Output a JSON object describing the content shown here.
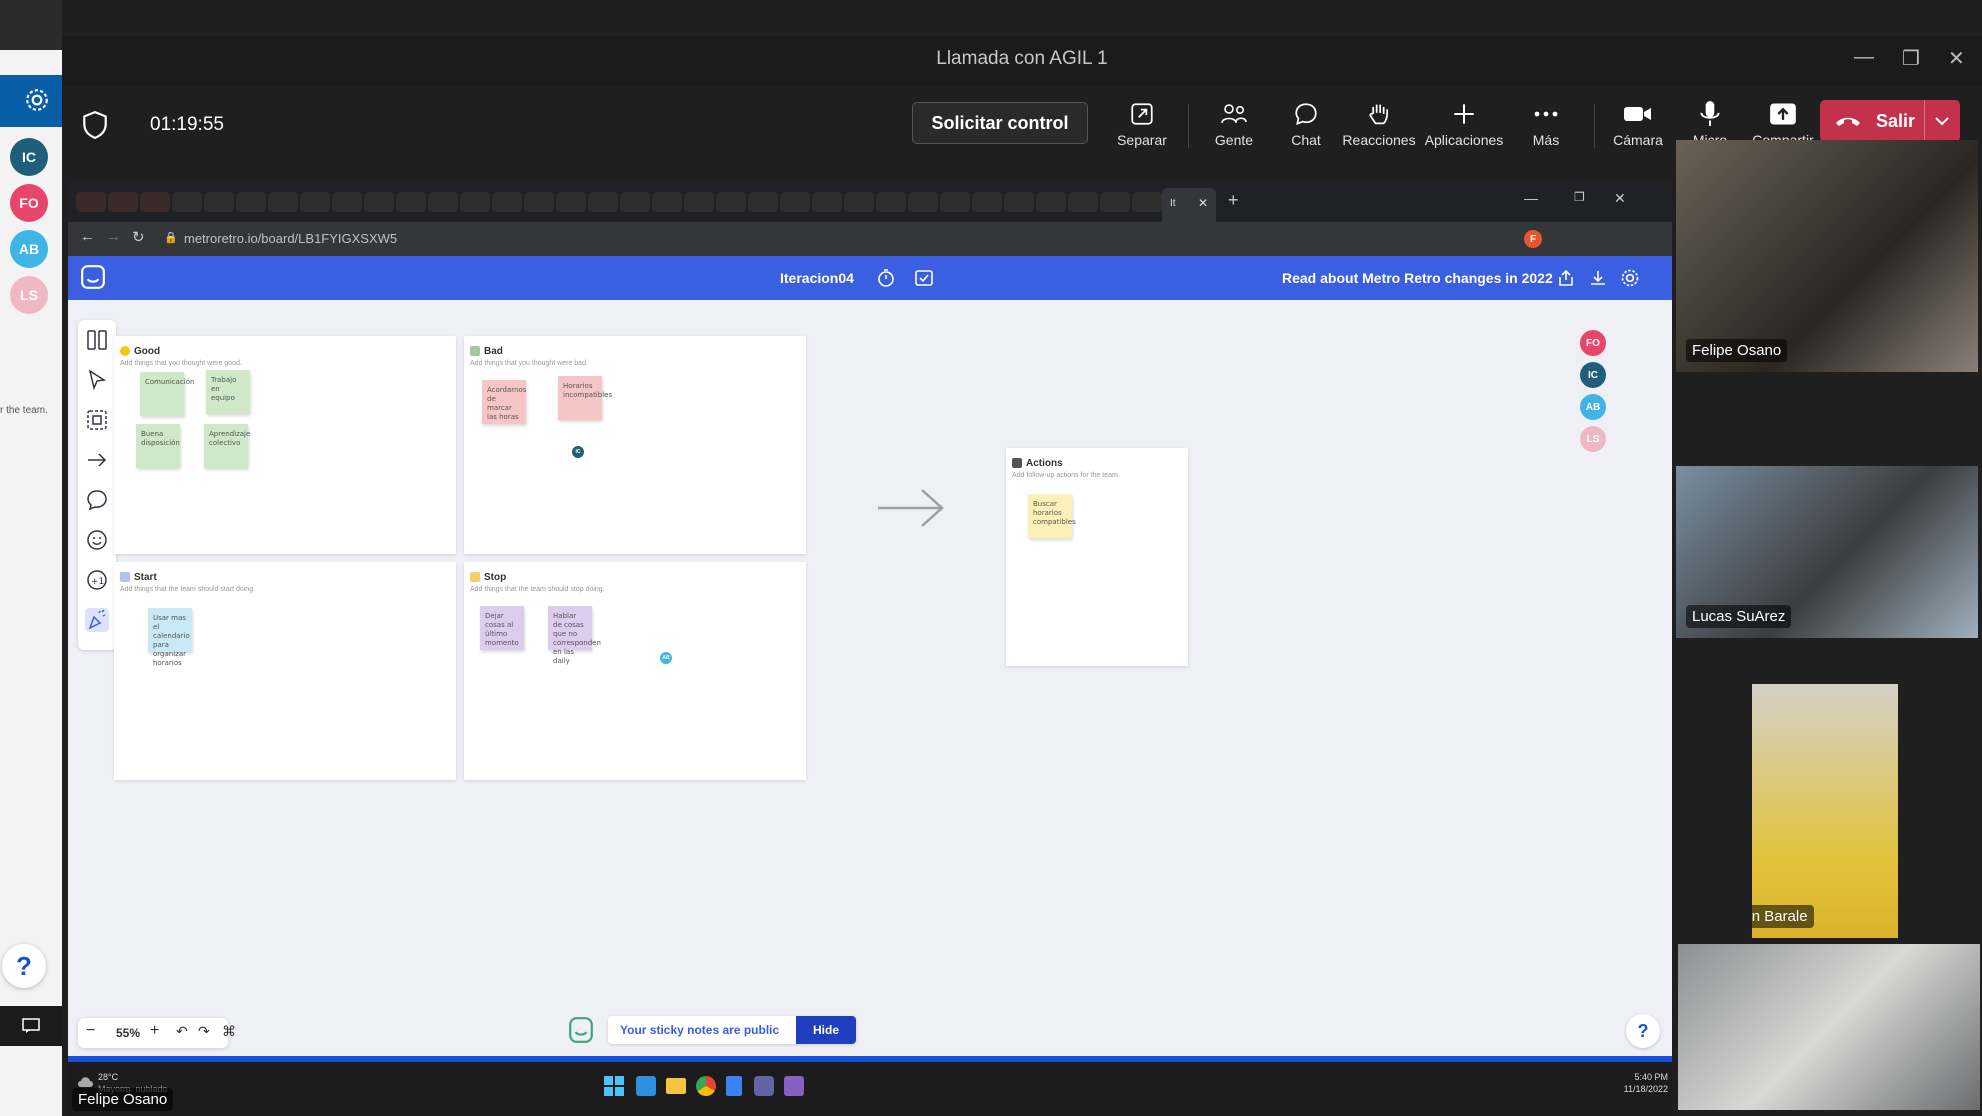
{
  "background_app": {
    "avatars": [
      {
        "initials": "IC",
        "color": "#1f5f7a"
      },
      {
        "initials": "FO",
        "color": "#e8456b"
      },
      {
        "initials": "AB",
        "color": "#3fb4e6"
      },
      {
        "initials": "LS",
        "color": "#f0b8c4"
      }
    ],
    "helper_text": "r the team.",
    "help_label": "?"
  },
  "window": {
    "title": "Llamada con AGIL 1"
  },
  "toolbar": {
    "timer": "01:19:55",
    "control_label": "Solicitar control",
    "items": [
      {
        "label": "Separar",
        "icon": "pop-out-icon"
      },
      {
        "label": "Gente",
        "icon": "people-icon"
      },
      {
        "label": "Chat",
        "icon": "chat-icon"
      },
      {
        "label": "Reacciones",
        "icon": "raise-hand-icon"
      },
      {
        "label": "Aplicaciones",
        "icon": "plus-icon"
      },
      {
        "label": "Más",
        "icon": "more-icon"
      },
      {
        "label": "Cámara",
        "icon": "camera-icon"
      },
      {
        "label": "Micro",
        "icon": "mic-icon"
      },
      {
        "label": "Compartir",
        "icon": "share-icon"
      }
    ],
    "leave_label": "Salir",
    "leave_color": "#c4314b"
  },
  "browser": {
    "url": "metroretro.io/board/LB1FYIGXSXW5",
    "active_tab": "It"
  },
  "metroretro": {
    "board_name": "Iteracion04",
    "news": "Read about Metro Retro changes in 2022",
    "accent": "#3a5fe0",
    "participants": [
      {
        "initials": "FO",
        "color": "#e8456b"
      },
      {
        "initials": "IC",
        "color": "#1f5f7a"
      },
      {
        "initials": "AB",
        "color": "#3fb4e6"
      },
      {
        "initials": "LS",
        "color": "#f0b8c4"
      }
    ],
    "boards": {
      "good": {
        "title": "Good",
        "subtitle": "Add things that you thought were good.",
        "stickies": [
          "Comunicación",
          "Trabajo en equipo",
          "Buena disposición",
          "Aprendizaje colectivo"
        ]
      },
      "bad": {
        "title": "Bad",
        "subtitle": "Add things that you thought were bad.",
        "stickies": [
          "Acordarnos de marcar las horas",
          "Horarios incompatibles"
        ]
      },
      "start": {
        "title": "Start",
        "subtitle": "Add things that the team should start doing.",
        "stickies": [
          "Usar mas el calendario para organizar horarios"
        ]
      },
      "stop": {
        "title": "Stop",
        "subtitle": "Add things that the team should stop doing.",
        "stickies": [
          "Dejar cosas al último momento",
          "Hablar de cosas que no corresponden en las daily"
        ]
      },
      "actions": {
        "title": "Actions",
        "subtitle": "Add follow-up actions for the team.",
        "stickies": [
          "Buscar horarios compatibles"
        ]
      }
    },
    "cursor_ic": "IC",
    "cursor_ab": "AB",
    "zoom": "55%",
    "public_note": "Your sticky notes are public",
    "hide_label": "Hide",
    "help_label": "?"
  },
  "taskbar": {
    "temperature": "28°C",
    "weather": "Mayorm. nublado",
    "time": "5:40 PM",
    "date": "11/18/2022"
  },
  "presenter": "Felipe Osano",
  "videos": [
    {
      "name": "Felipe Osano"
    },
    {
      "name": "Lucas SuArez"
    },
    {
      "name": "Agustin Barale"
    },
    {
      "name": ""
    }
  ]
}
